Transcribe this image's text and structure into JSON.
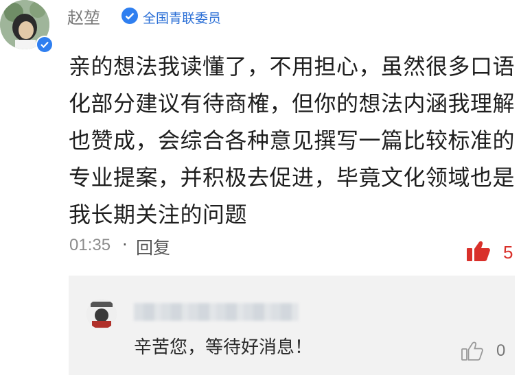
{
  "comment": {
    "author": "赵堃",
    "certification": "全国青联委员",
    "text": "亲的想法我读懂了，不用担心，虽然很多口语化部分建议有待商榷，但你的想法内涵我理解也赞成，会综合各种意见撰写一篇比较标准的专业提案，并积极去促进，毕竟文化领域也是我长期关注的问题",
    "time": "01:35",
    "separator": "·",
    "reply_label": "回复",
    "like_count": "5",
    "like_icon": "thumbs-up-icon",
    "like_color": "#d9302a"
  },
  "reply": {
    "text": "辛苦您，等待好消息！",
    "like_count": "0",
    "like_icon": "thumbs-up-outline-icon"
  },
  "colors": {
    "verified_blue": "#2f7ff0",
    "reply_bg": "#f2f2f2"
  }
}
